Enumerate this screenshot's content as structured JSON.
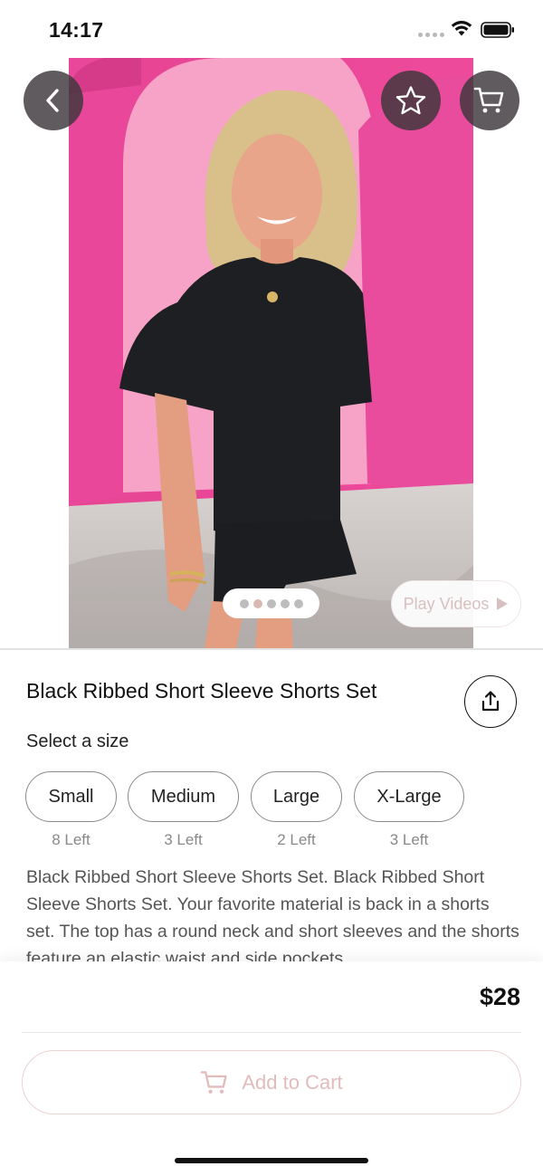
{
  "status_bar": {
    "time": "14:17"
  },
  "product": {
    "title": "Black Ribbed Short Sleeve Shorts Set",
    "price": "$28",
    "image_count": 5,
    "active_image_index": 1,
    "description": "Black Ribbed Short Sleeve Shorts Set. Black Ribbed Short Sleeve Shorts Set.  Your favorite material is back in a shorts set.  The top has a round neck and short sleeves and the shorts feature an elastic waist and side pockets."
  },
  "media": {
    "play_videos_label": "Play Videos"
  },
  "size_selector": {
    "label": "Select a size",
    "options": [
      {
        "label": "Small",
        "stock": "8 Left"
      },
      {
        "label": "Medium",
        "stock": "3 Left"
      },
      {
        "label": "Large",
        "stock": "2 Left"
      },
      {
        "label": "X-Large",
        "stock": "3 Left"
      }
    ]
  },
  "actions": {
    "add_to_cart_label": "Add to Cart"
  },
  "colors": {
    "accent_disabled": "#e2bcbc",
    "nav_button_bg": "#3c373a",
    "backdrop_pink": "#e8489a"
  },
  "icons": [
    "chevron-left-icon",
    "star-icon",
    "cart-icon",
    "share-icon",
    "play-icon",
    "wifi-icon",
    "battery-icon"
  ]
}
